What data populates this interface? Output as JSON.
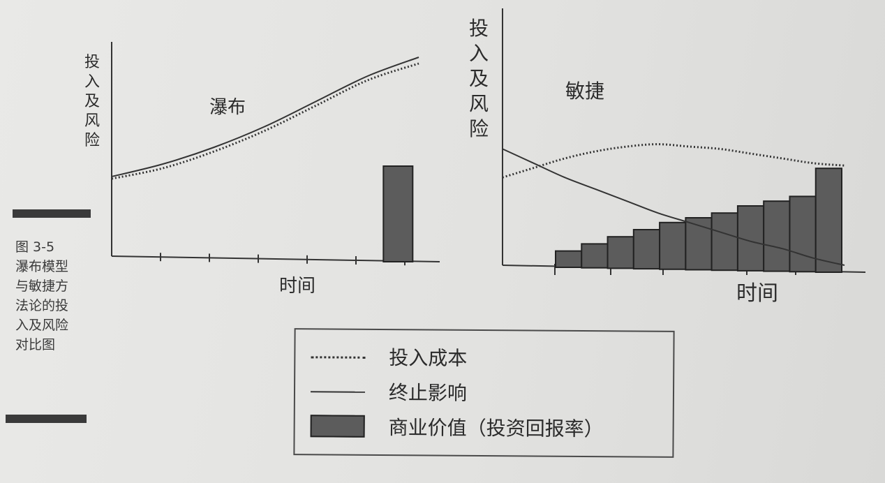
{
  "caption": {
    "lines": [
      "图 3-5",
      "瀑布模型",
      "与敏捷方",
      "法论的投",
      "入及风险",
      "对比图"
    ]
  },
  "legend": {
    "items": [
      {
        "label": "投入成本",
        "style": "dotted"
      },
      {
        "label": "终止影响",
        "style": "solid"
      },
      {
        "label": "商业价值（投资回报率）",
        "style": "bar"
      }
    ]
  },
  "chart_data": [
    {
      "type": "line",
      "title": "瀑布",
      "xlabel": "时间",
      "ylabel": "投入及风险",
      "x": [
        0,
        1,
        2,
        3,
        4,
        5,
        6
      ],
      "xlim": [
        0,
        6
      ],
      "ylim": [
        0,
        100
      ],
      "grid": false,
      "series": [
        {
          "name": "终止影响",
          "style": "solid",
          "values": [
            38,
            44,
            52,
            62,
            74,
            86,
            95
          ]
        },
        {
          "name": "投入成本",
          "style": "dotted",
          "values": [
            37,
            42,
            50,
            60,
            72,
            84,
            92
          ]
        }
      ],
      "bars": [
        {
          "name": "商业价值（投资回报率）",
          "x": 5.5,
          "value": 43
        }
      ]
    },
    {
      "type": "line",
      "title": "敏捷",
      "xlabel": "时间",
      "ylabel": "投入及风险",
      "x": [
        0,
        1,
        2,
        3,
        4,
        5,
        6,
        7,
        8,
        9,
        10,
        11
      ],
      "xlim": [
        0,
        11
      ],
      "ylim": [
        0,
        100
      ],
      "grid": false,
      "series": [
        {
          "name": "投入成本",
          "style": "dotted",
          "values": [
            37,
            41,
            45,
            48,
            50,
            51,
            50,
            49,
            47,
            45,
            43,
            42
          ]
        },
        {
          "name": "终止影响",
          "style": "solid",
          "values": [
            49,
            43,
            37,
            32,
            27,
            22,
            18,
            14,
            10,
            7,
            3,
            0
          ]
        }
      ],
      "bars_categories": [
        1,
        2,
        3,
        4,
        5,
        6,
        7,
        8,
        9,
        10,
        11
      ],
      "bars": [
        6,
        9,
        12,
        15,
        18,
        20,
        22,
        25,
        27,
        29,
        32
      ]
    }
  ]
}
